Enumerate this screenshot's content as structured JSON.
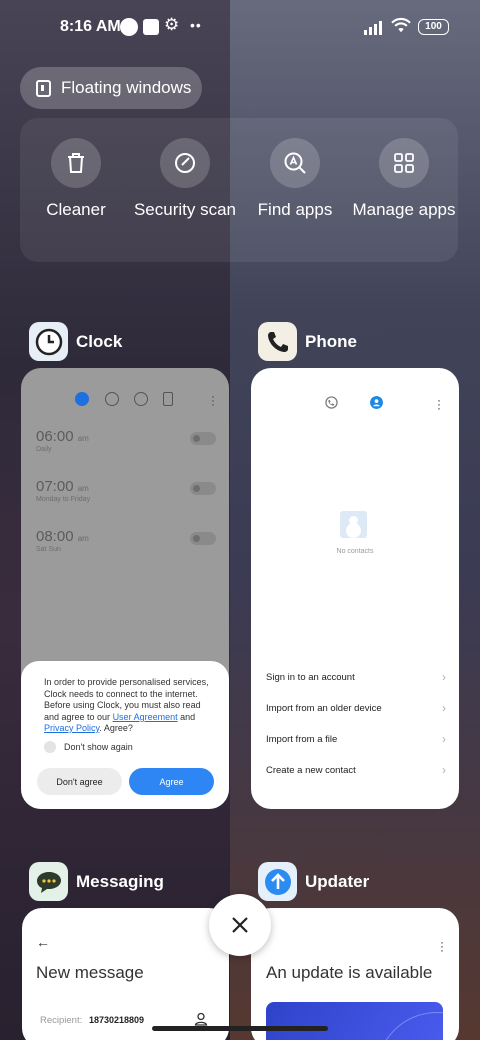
{
  "status_bar": {
    "time": "8:16 AM",
    "battery": "100"
  },
  "floating_windows": {
    "label": "Floating windows"
  },
  "quick_actions": [
    {
      "label": "Cleaner",
      "icon": "trash-icon"
    },
    {
      "label": "Security scan",
      "icon": "shield-check-icon"
    },
    {
      "label": "Find apps",
      "icon": "search-apps-icon"
    },
    {
      "label": "Manage apps",
      "icon": "grid-icon"
    }
  ],
  "apps": {
    "clock": {
      "name": "Clock",
      "alarms": [
        {
          "time": "06:00",
          "ampm": "am",
          "repeat": "Daily"
        },
        {
          "time": "07:00",
          "ampm": "am",
          "repeat": "Monday to Friday"
        },
        {
          "time": "08:00",
          "ampm": "am",
          "repeat": "Sat Sun"
        }
      ],
      "dialog": {
        "text_before": "In order to provide personalised services, Clock needs to connect to the internet. Before using Clock, you must also read and agree to our ",
        "link_agreement": "User Agreement",
        "text_and": " and ",
        "link_privacy": "Privacy Policy",
        "text_after": ". Agree?",
        "checkbox_label": "Don't show again",
        "disagree": "Don't agree",
        "agree": "Agree"
      }
    },
    "phone": {
      "name": "Phone",
      "empty_text": "No contacts",
      "items": [
        "Sign in to an account",
        "Import from an older device",
        "Import from a file",
        "Create a new contact"
      ]
    },
    "messaging": {
      "name": "Messaging",
      "title": "New message",
      "recipient_label": "Recipient:",
      "recipient_value": "18730218809"
    },
    "updater": {
      "name": "Updater",
      "title": "An update is available"
    }
  },
  "colors": {
    "accent": "#2e86f5",
    "link": "#1e6fe0"
  }
}
